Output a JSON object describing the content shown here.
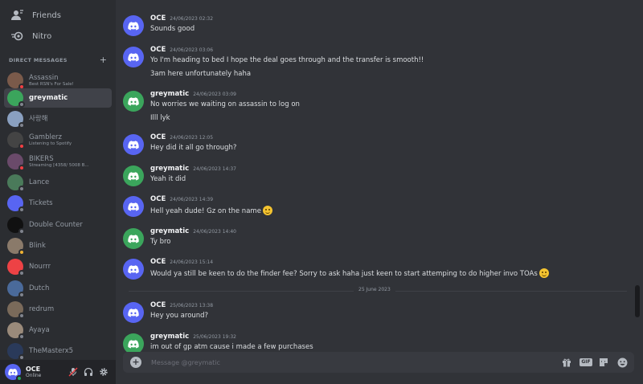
{
  "sidebar": {
    "nav": [
      {
        "label": "Friends",
        "icon": "friends-icon"
      },
      {
        "label": "Nitro",
        "icon": "nitro-icon"
      }
    ],
    "dm_header": "DIRECT MESSAGES",
    "dms": [
      {
        "name": "Assassin",
        "sub": "Best RSN's For Sale!",
        "color": "#7a5a4a",
        "status": "#f23f43"
      },
      {
        "name": "greymatic",
        "sub": "",
        "color": "#3ba55c",
        "status": "#80848e",
        "active": true
      },
      {
        "name": "사랑해",
        "sub": "",
        "color": "#8aa0c0",
        "status": "#80848e"
      },
      {
        "name": "Gamblerz",
        "sub": "Listening to Spotify",
        "color": "#444",
        "status": "#f23f43"
      },
      {
        "name": "BIKERS",
        "sub": "Streaming [4358/ 5008 B...",
        "color": "#6a4a6a",
        "status": "#f23f43"
      },
      {
        "name": "Lance",
        "sub": "",
        "color": "#4a7a5a",
        "status": "#80848e"
      },
      {
        "name": "Tickets",
        "sub": "",
        "color": "#5865f2",
        "status": "#80848e"
      },
      {
        "name": "Double Counter",
        "sub": "",
        "color": "#111111",
        "status": "#80848e"
      },
      {
        "name": "Blink",
        "sub": "",
        "color": "#8a7a6a",
        "status": "#f0b232"
      },
      {
        "name": "Nourrr",
        "sub": "",
        "color": "#ed4245",
        "status": "#80848e"
      },
      {
        "name": "Dutch",
        "sub": "",
        "color": "#4a6a9a",
        "status": "#80848e"
      },
      {
        "name": "redrum",
        "sub": "",
        "color": "#7a6a5a",
        "status": "#80848e"
      },
      {
        "name": "Ayaya",
        "sub": "",
        "color": "#9a8a7a",
        "status": "#80848e"
      },
      {
        "name": "TheMasterx5",
        "sub": "",
        "color": "#2a3a5a",
        "status": "#80848e"
      }
    ],
    "user": {
      "name": "OCE",
      "status": "Online"
    }
  },
  "messages": [
    {
      "author": "OCE",
      "time": "24/06/2023 02:32",
      "lines": [
        "Sounds good"
      ],
      "color": "#5865f2"
    },
    {
      "author": "OCE",
      "time": "24/06/2023 03:06",
      "lines": [
        "Yo I'm heading to bed I hope the deal goes through and the transfer is smooth!!",
        "3am here unfortunately haha"
      ],
      "color": "#5865f2"
    },
    {
      "author": "greymatic",
      "time": "24/06/2023 03:09",
      "lines": [
        "No worries we waiting on assassin to log on",
        "Illl lyk"
      ],
      "color": "#3ba55c"
    },
    {
      "author": "OCE",
      "time": "24/06/2023 12:05",
      "lines": [
        "Hey did it all go through?"
      ],
      "color": "#5865f2"
    },
    {
      "author": "greymatic",
      "time": "24/06/2023 14:37",
      "lines": [
        "Yeah it did"
      ],
      "color": "#3ba55c"
    },
    {
      "author": "OCE",
      "time": "24/06/2023 14:39",
      "lines": [
        "Hell yeah dude! Gz on the name"
      ],
      "color": "#5865f2"
    },
    {
      "author": "greymatic",
      "time": "24/06/2023 14:40",
      "lines": [
        "Ty bro"
      ],
      "color": "#3ba55c"
    },
    {
      "author": "OCE",
      "time": "24/06/2023 15:14",
      "lines": [
        "Would ya still be keen to do the finder fee? Sorry to ask haha just keen to start attemping to do higher invo TOAs"
      ],
      "color": "#5865f2"
    },
    {
      "author": "OCE",
      "time": "25/06/2023 13:38",
      "lines": [
        "Hey you around?"
      ],
      "color": "#5865f2"
    },
    {
      "author": "greymatic",
      "time": "25/06/2023 19:32",
      "lines": [
        "im out of gp atm cause i made a few purchases"
      ],
      "color": "#3ba55c"
    }
  ],
  "date_divider": "25 June 2023",
  "composer": {
    "placeholder": "Message @greymatic",
    "gif_label": "GIF"
  },
  "colors": {
    "blurple": "#5865f2",
    "green": "#3ba55c",
    "background": "#313338",
    "sidebar": "#2b2d31"
  }
}
